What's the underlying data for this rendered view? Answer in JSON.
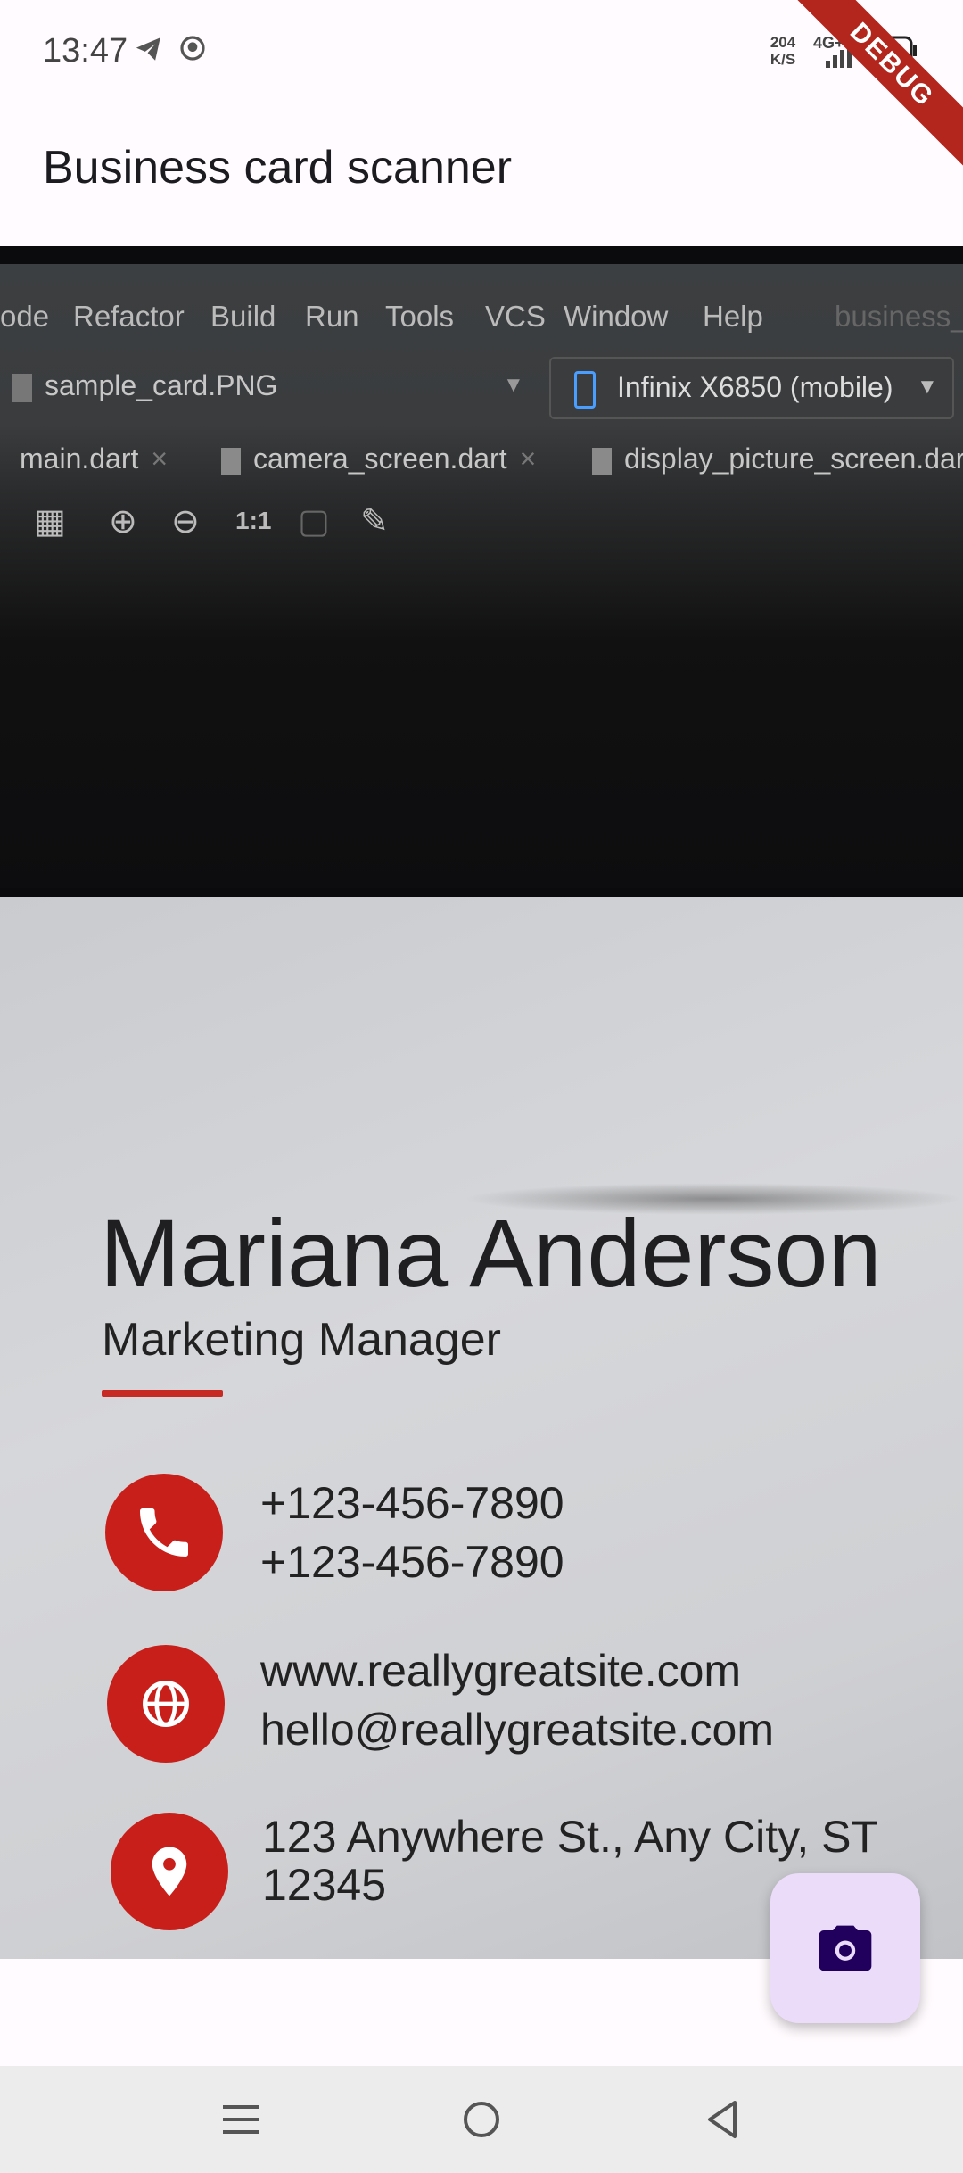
{
  "status_bar": {
    "time": "13:47",
    "net_speed_value": "204",
    "net_speed_unit": "K/S",
    "network_type": "4G+",
    "battery": "100",
    "debug_banner": "DEBUG"
  },
  "app_bar": {
    "title": "Business card scanner"
  },
  "camera_preview": {
    "ide_menu": [
      "ode",
      "Refactor",
      "Build",
      "Run",
      "Tools",
      "VCS",
      "Window",
      "Help",
      "business_c"
    ],
    "ide_open_file": "sample_card.PNG",
    "ide_device": "Infinix X6850 (mobile)",
    "ide_tabs": [
      "main.dart",
      "camera_screen.dart",
      "display_picture_screen.dart"
    ],
    "ide_zoom_label": "1:1",
    "card": {
      "name": "Mariana Anderson",
      "role": "Marketing Manager",
      "phone_1": "+123-456-7890",
      "phone_2": "+123-456-7890",
      "website": "www.reallygreatsite.com",
      "email": "hello@reallygreatsite.com",
      "address_line_1": "123 Anywhere St., Any City, ST",
      "address_line_2": "12345"
    }
  },
  "fab": {
    "icon": "camera-icon"
  },
  "nav_bar": {
    "icons": [
      "menu-icon",
      "home-icon",
      "back-icon"
    ]
  },
  "colors": {
    "accent": "#c91f1a",
    "fab_bg": "#ebdcfa",
    "fab_icon": "#21005d"
  }
}
